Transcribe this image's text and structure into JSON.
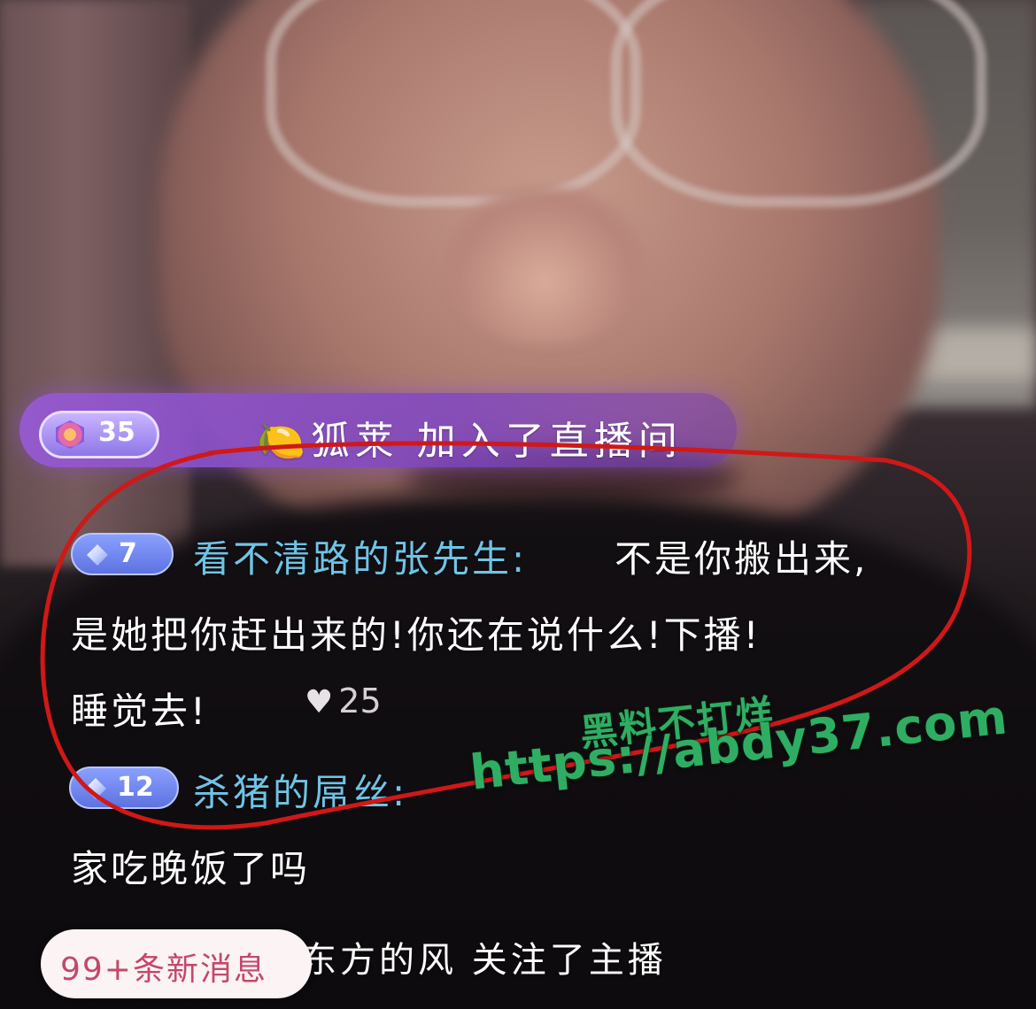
{
  "join_banner": {
    "level": "35",
    "message": "🍋狐莱 加入了直播间"
  },
  "messages": [
    {
      "level": "7",
      "username": "看不清路的张先生:",
      "lines": [
        "不是你搬出来,",
        "是她把你赶出来的!你还在说什么!下播!",
        "睡觉去!"
      ],
      "likes": "25"
    },
    {
      "level": "12",
      "username": "杀猪的屌丝:",
      "lines": [
        "家吃晚饭了吗"
      ]
    }
  ],
  "watermark": {
    "text": "黑料不打烊",
    "url": "https://abdy37.com"
  },
  "bottom": {
    "new_messages": "99+条新消息",
    "follow_notice": "东方的风 关注了主播"
  },
  "colors": {
    "username": "#6fc4e6",
    "annotation": "#d01818",
    "watermark": "#2fae63",
    "banner": "#8a4fd0"
  }
}
